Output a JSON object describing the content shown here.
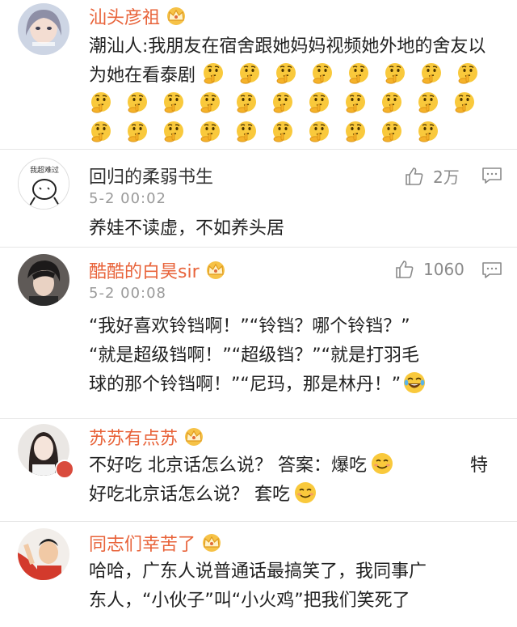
{
  "comments": [
    {
      "name": "汕头彦祖",
      "name_style": "vip",
      "text": "潮汕人:我朋友在宿舍跟她妈妈视频她外地的舍友以为她在看泰剧"
    },
    {
      "name": "回归的柔弱书生",
      "time": "5-2 00:02",
      "likes": "2万",
      "text": "养娃不读虚，不如养头居",
      "avatar_text": "我超难过"
    },
    {
      "name": "酷酷的白昊sir",
      "time": "5-2 00:08",
      "likes": "1060",
      "lines": [
        "“我好喜欢铃铛啊！”“铃铛？哪个铃铛？”",
        "“就是超级铛啊！”“超级铛？”“就是打羽毛",
        "球的那个铃铛啊！”“尼玛，那是林丹！”"
      ]
    },
    {
      "name": "苏苏有点苏",
      "line1a": "不好吃 北京话怎么说？ 答案：爆吃",
      "line1b": "特",
      "line2": "好吃北京话怎么说？ 套吃"
    },
    {
      "name": "同志们幸苦了",
      "lines": [
        "哈哈，广东人说普通话最搞笑了，我同事广",
        "东人，“小伙子”叫“小火鸡”把我们笑死了"
      ]
    }
  ],
  "colors": {
    "vip_name": "#e8633a",
    "time": "#9a9a9a",
    "crown": "#f2b233",
    "divider": "#e6e6e6"
  },
  "icons": {
    "crown": "crown-icon",
    "like": "thumbs-up-icon",
    "reply": "comment-icon",
    "emoji_thinking": "thinking-face-icon",
    "emoji_laugh": "tears-of-joy-icon",
    "emoji_smile": "smiling-face-icon"
  }
}
